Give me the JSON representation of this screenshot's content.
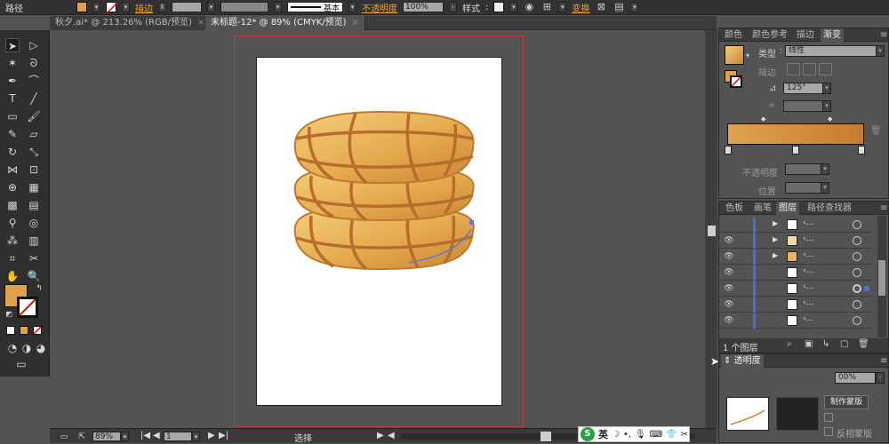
{
  "control_bar": {
    "object_type": "路径",
    "stroke_label": "描边",
    "stroke_profile": "基本",
    "opacity_label": "不透明度",
    "opacity_value": "100%",
    "style_label": "样式",
    "transform_label": "变换"
  },
  "document_tabs": [
    {
      "label": "秋夕.ai* @ 213.26% (RGB/预览)",
      "close": "×"
    },
    {
      "label": "未标题-12* @ 89% (CMYK/预览)",
      "close": "×"
    }
  ],
  "status_bar": {
    "zoom": "89%",
    "page": "1",
    "tool_label": "选择"
  },
  "color_panel": {
    "tabs": [
      "颜色",
      "颜色参考",
      "描边",
      "渐变"
    ],
    "type_label": "类型",
    "type_value": "线性",
    "stroke_label": "描边",
    "angle_value": "125°",
    "opacity_label": "不透明度",
    "position_label": "位置",
    "gradient_start": "#e0a24e",
    "gradient_end": "#c87b2e"
  },
  "layers_panel": {
    "tabs": [
      "色板",
      "画笔",
      "图层",
      "路径查找器"
    ],
    "layer_count": "1 个图层",
    "row_names": [
      "‹...",
      "‹...",
      "‹...",
      "‹...",
      "‹...",
      "‹...",
      "‹..."
    ]
  },
  "transparency_panel": {
    "title": "透明度",
    "opacity_value": "00%",
    "make_mask": "制作蒙版",
    "invert_mask": "反相蒙版"
  },
  "ime_bar": {
    "lang": "英"
  },
  "colors": {
    "fill": "#e0a24e",
    "accent_orange": "#e8a13a",
    "artboard_outline": "#c0393b",
    "layer_bar": "#4a6fcf"
  }
}
